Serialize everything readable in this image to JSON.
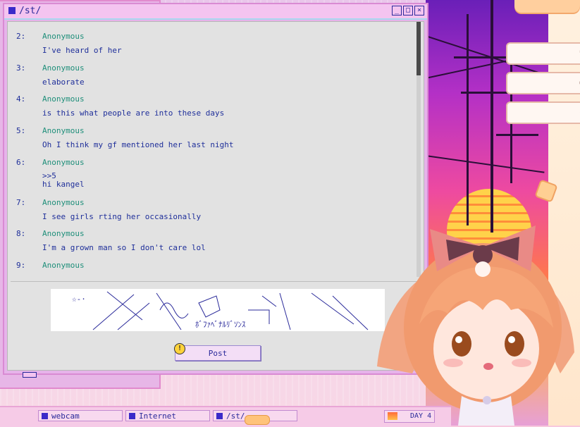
{
  "window": {
    "title": "/st/",
    "minimize": "_",
    "maximize": "□",
    "close": "×"
  },
  "posts": [
    {
      "num": "2:",
      "author": "Anonymous",
      "body": "I've heard of her"
    },
    {
      "num": "3:",
      "author": "Anonymous",
      "body": "elaborate"
    },
    {
      "num": "4:",
      "author": "Anonymous",
      "body": "is this what people are into these days"
    },
    {
      "num": "5:",
      "author": "Anonymous",
      "body": "Oh I think my gf mentioned her last night"
    },
    {
      "num": "6:",
      "author": "Anonymous",
      "body": ">>5\nhi kangel"
    },
    {
      "num": "7:",
      "author": "Anonymous",
      "body": "I see girls rting her occasionally"
    },
    {
      "num": "8:",
      "author": "Anonymous",
      "body": "I'm a grown man so I don't care lol"
    },
    {
      "num": "9:",
      "author": "Anonymous",
      "body": ""
    }
  ],
  "captcha": {
    "text_star": "☆-·",
    "text_kana": "ﾎﾞﾌｧﾍﾞﾅﾙﾘﾞｿﾝｽ"
  },
  "info_icon": "!",
  "post_button": "Post",
  "taskbar": {
    "items": [
      {
        "label": "webcam"
      },
      {
        "label": "Internet"
      },
      {
        "label": "/st/"
      }
    ],
    "clock": "DAY 4"
  },
  "colors": {
    "accent": "#3b2ac9",
    "text_blue": "#1f2f9a",
    "author_green": "#1f8f7a",
    "window_pink": "#f4c4f0"
  }
}
